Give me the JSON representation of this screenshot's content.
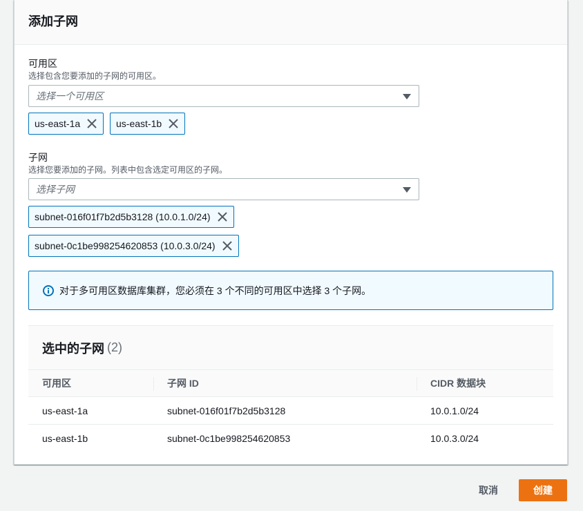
{
  "panel": {
    "title": "添加子网"
  },
  "az": {
    "label": "可用区",
    "description": "选择包含您要添加的子网的可用区。",
    "placeholder": "选择一个可用区",
    "tokens": [
      "us-east-1a",
      "us-east-1b"
    ]
  },
  "subnet": {
    "label": "子网",
    "description": "选择您要添加的子网。列表中包含选定可用区的子网。",
    "placeholder": "选择子网",
    "tokens": [
      "subnet-016f01f7b2d5b3128 (10.0.1.0/24)",
      "subnet-0c1be998254620853 (10.0.3.0/24)"
    ]
  },
  "alert": {
    "text": "对于多可用区数据库集群，您必须在 3 个不同的可用区中选择 3 个子网。",
    "icon": "info-icon"
  },
  "table": {
    "title": "选中的子网",
    "count": "(2)",
    "columns": [
      "可用区",
      "子网 ID",
      "CIDR 数据块"
    ],
    "rows": [
      [
        "us-east-1a",
        "subnet-016f01f7b2d5b3128",
        "10.0.1.0/24"
      ],
      [
        "us-east-1b",
        "subnet-0c1be998254620853",
        "10.0.3.0/24"
      ]
    ]
  },
  "footer": {
    "cancel_label": "取消",
    "create_label": "创建"
  },
  "colors": {
    "accent": "#0073bb",
    "primary_button": "#ec7211",
    "token_bg": "#f1faff"
  }
}
